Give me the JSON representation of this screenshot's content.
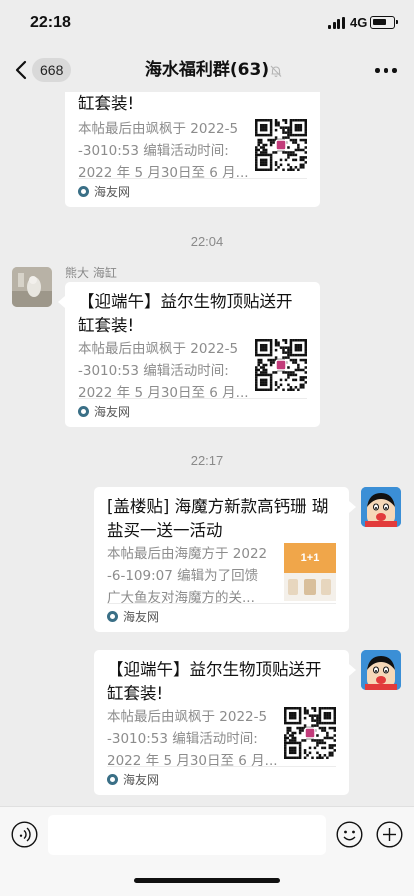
{
  "status_bar": {
    "time": "22:18",
    "network": "4G"
  },
  "nav": {
    "back_icon": "chevron-left-icon",
    "unread_count": "668",
    "title": "海水福利群(63)",
    "mute_icon": "bell-slash-icon",
    "more_icon": "ellipsis-icon"
  },
  "messages": [
    {
      "title_line2": "缸套装!",
      "desc": [
        "本帖最后由飒枫于 2022-5",
        "-3010:53 编辑活动时间:",
        "2022 年 5 月30日至 6 月..."
      ],
      "source": "海友网"
    },
    {
      "time": "22:04",
      "sender": "熊大 海缸",
      "title": [
        "【迎端午】益尔生物顶贴送开",
        "缸套装!"
      ],
      "desc": [
        "本帖最后由飒枫于 2022-5",
        "-3010:53 编辑活动时间:",
        "2022 年 5 月30日至 6 月..."
      ],
      "source": "海友网"
    },
    {
      "time": "22:17",
      "title": [
        "[盖楼贴] 海魔方新款高钙珊 瑚",
        "盐买一送一活动"
      ],
      "desc": [
        "本帖最后由海魔方于 2022",
        "-6-109:07 编辑为了回馈",
        "广大鱼友对海魔方的关..."
      ],
      "thumb_text": "1+1",
      "source": "海友网"
    },
    {
      "title": [
        "【迎端午】益尔生物顶贴送开",
        "缸套装!"
      ],
      "desc": [
        "本帖最后由飒枫于 2022-5",
        "-3010:53 编辑活动时间:",
        "2022 年 5 月30日至 6 月..."
      ],
      "source": "海友网"
    }
  ],
  "input_bar": {
    "voice_icon": "voice-icon",
    "emoji_icon": "emoji-icon",
    "plus_icon": "plus-circle-icon"
  }
}
